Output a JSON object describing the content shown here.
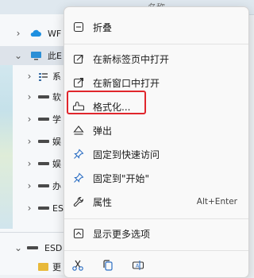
{
  "explorer": {
    "column_header": "名称",
    "tree": [
      {
        "label": "WF",
        "icon": "cloud-icon",
        "expanded": false
      },
      {
        "label": "此E",
        "icon": "computer-icon",
        "expanded": true
      },
      {
        "label": "系",
        "icon": "gallery-icon",
        "expanded": false
      },
      {
        "label": "软",
        "icon": "drive-icon",
        "expanded": false
      },
      {
        "label": "学",
        "icon": "drive-icon",
        "expanded": false
      },
      {
        "label": "娱",
        "icon": "drive-icon",
        "expanded": false
      },
      {
        "label": "娱",
        "icon": "drive-icon",
        "expanded": false
      },
      {
        "label": "办",
        "icon": "drive-icon",
        "expanded": false
      },
      {
        "label": "ES",
        "icon": "drive-icon",
        "expanded": false
      },
      {
        "label": "ESD",
        "icon": "drive-icon",
        "expanded": true
      },
      {
        "label": "更",
        "icon": "folder-icon",
        "expanded": false
      }
    ]
  },
  "context_menu": {
    "items": [
      {
        "label": "折叠",
        "icon": "collapse-icon"
      },
      {
        "label": "在新标签页中打开",
        "icon": "new-tab-icon"
      },
      {
        "label": "在新窗口中打开",
        "icon": "new-window-icon"
      },
      {
        "label": "格式化...",
        "icon": "format-icon",
        "highlighted": true
      },
      {
        "label": "弹出",
        "icon": "eject-icon"
      },
      {
        "label": "固定到快速访问",
        "icon": "pin-icon"
      },
      {
        "label": "固定到\"开始\"",
        "icon": "pin-start-icon"
      },
      {
        "label": "属性",
        "icon": "properties-icon",
        "shortcut": "Alt+Enter"
      },
      {
        "label": "显示更多选项",
        "icon": "more-options-icon"
      }
    ],
    "bottom_actions": [
      {
        "icon": "cut-icon"
      },
      {
        "icon": "copy-icon"
      },
      {
        "icon": "rename-icon"
      }
    ],
    "highlight_color": "#e0262c"
  }
}
